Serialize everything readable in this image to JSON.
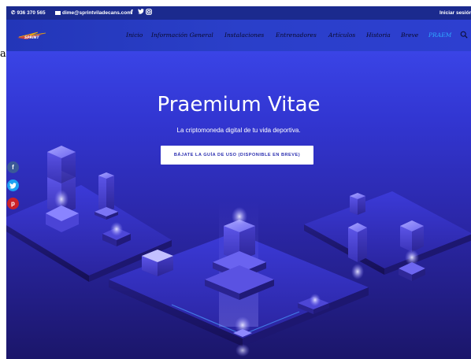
{
  "stray_char": "a",
  "topbar": {
    "phone": "936 370 565",
    "email": "dime@sprintviladecans.com",
    "facebook_icon": "f",
    "twitter_icon": "🐦",
    "instagram_icon": "◎",
    "login": "Iniciar sesión"
  },
  "logo": {
    "text": "SPRINT"
  },
  "nav": {
    "items": [
      {
        "label": "Inicio"
      },
      {
        "label": "Información General"
      },
      {
        "label": "Instalaciones"
      },
      {
        "label": "Entrenadores"
      },
      {
        "label": "Artículos"
      },
      {
        "label": "Historia"
      },
      {
        "label": "Breve"
      },
      {
        "label": "PRAEM"
      }
    ],
    "active_index": 7,
    "search_icon": "search-icon"
  },
  "hero": {
    "title": "Praemium Vitae",
    "subtitle": "La criptomoneda digital de tu vida deportiva.",
    "cta": "BÁJATE LA GUÍA DE USO (DISPONIBLE EN BREVE)"
  },
  "social": {
    "facebook": "f",
    "twitter": "t",
    "pinterest": "p"
  },
  "colors": {
    "topbar": "#1b2a8e",
    "nav": "#2a3fc9",
    "accent": "#2fa9ff",
    "hero_top": "#3a44e6",
    "hero_bottom": "#1b166a"
  }
}
